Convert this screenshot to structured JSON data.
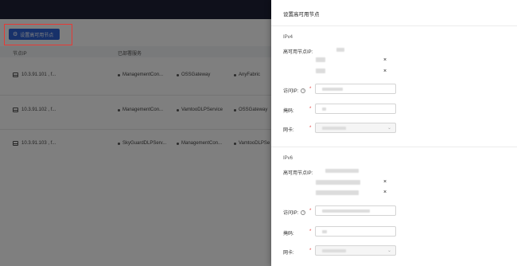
{
  "toolbar": {
    "setup_label": "设置高可用节点"
  },
  "table": {
    "headers": [
      "节点IP",
      "已部署服务"
    ],
    "rows": [
      {
        "ip": "10.3.91.101 , f...",
        "services": [
          "ManagementCon...",
          "OSSGateway",
          "AnyFabric"
        ]
      },
      {
        "ip": "10.3.91.102 , f...",
        "services": [
          "ManagementCon...",
          "VamtooDLPService",
          "OSSGateway"
        ]
      },
      {
        "ip": "10.3.91.103 , f...",
        "services": [
          "SkyGuardDLPServ...",
          "ManagementCon...",
          "VamtooDLPSe"
        ]
      }
    ]
  },
  "drawer": {
    "title": "设置高可用节点",
    "ipv4": {
      "section": "IPv4",
      "nodes_label": "高可用节点IP:",
      "access_label": "访问IP:",
      "mask_label": "掩码:",
      "nic_label": "网卡:"
    },
    "ipv6": {
      "section": "IPv6",
      "nodes_label": "高可用节点IP:",
      "access_label": "访问IP:",
      "mask_label": "掩码:",
      "nic_label": "网卡:"
    },
    "required_mark": "*",
    "help_mark": "?",
    "close_mark": "×",
    "chevron": "⌄"
  },
  "colors": {
    "primary": "#2f62d4",
    "topbar": "#1e2136",
    "highlight": "#e53935"
  }
}
